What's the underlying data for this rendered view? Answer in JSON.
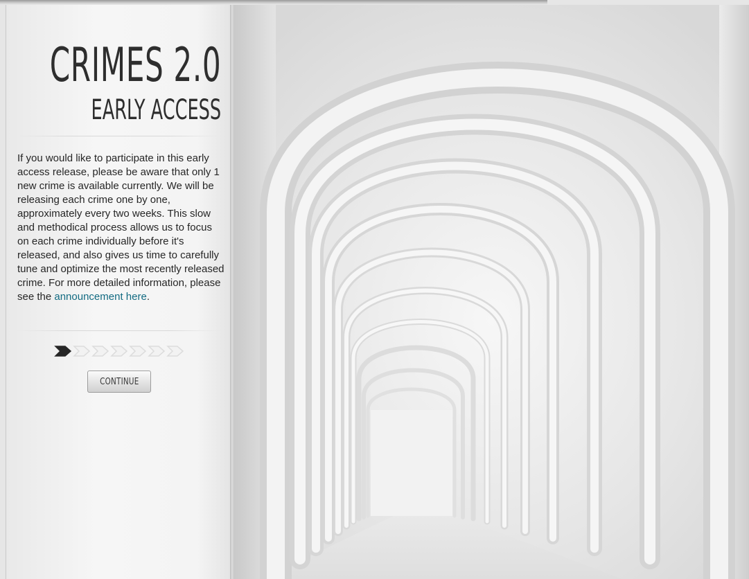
{
  "panel": {
    "title": "CRIMES 2.0",
    "subtitle": "EARLY ACCESS",
    "body_text": "If you would like to participate in this early access release, please be aware that only 1 new crime is available currently. We will be releasing each crime one by one, approximately every two weeks. This slow and methodical process allows us to focus on each crime individually before it's released, and also gives us time to carefully tune and optimize the most recently released crime. For more detailed information, please see the ",
    "link_text": "announcement here",
    "body_end": ".",
    "steps": {
      "total": 7,
      "current": 1
    },
    "continue_label": "CONTINUE"
  },
  "colors": {
    "link": "#136b82",
    "text": "#262626",
    "step_active": "#262626",
    "step_inactive": "#dcdcdc"
  },
  "icons": {
    "step": "chevron-arrow-icon"
  }
}
